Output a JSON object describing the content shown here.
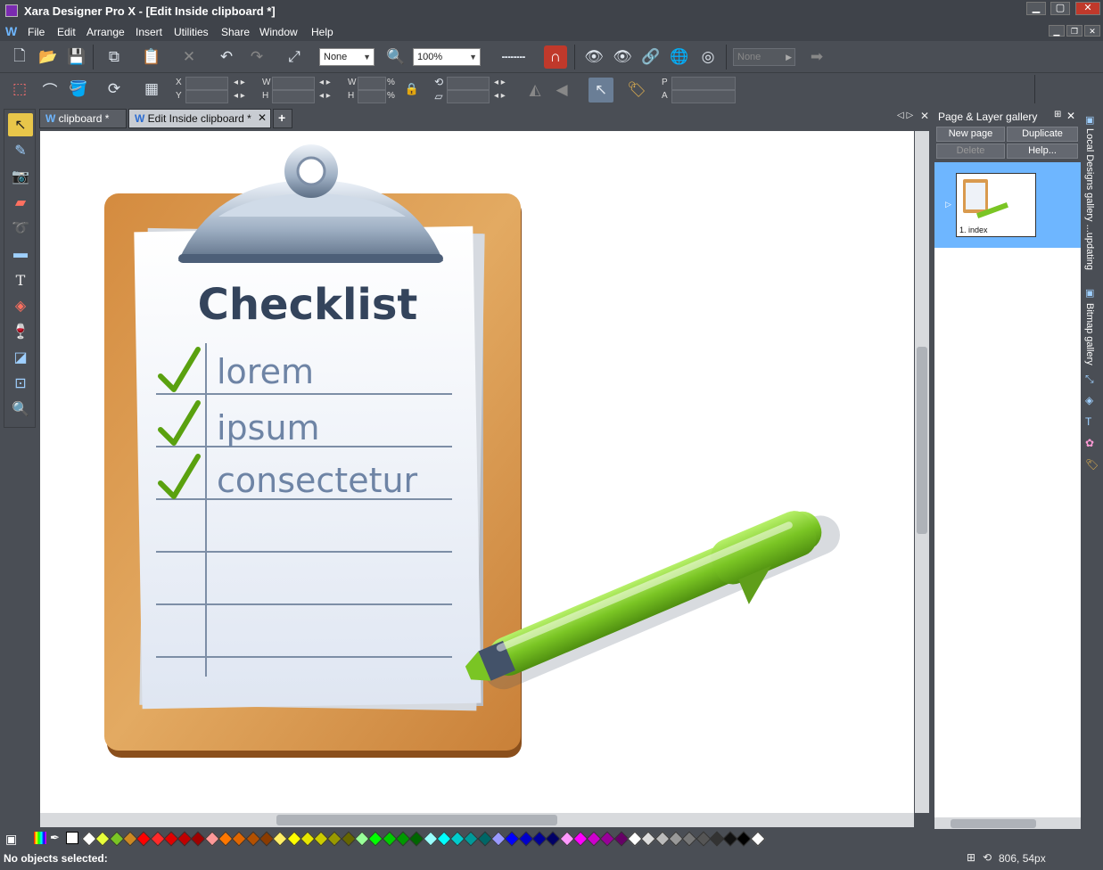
{
  "window": {
    "title": "Xara Designer Pro X - [Edit Inside clipboard *]"
  },
  "menu": [
    "File",
    "Edit",
    "Arrange",
    "Insert",
    "Utilities",
    "Share",
    "Window",
    "Help"
  ],
  "toolbar": {
    "quality_value": "None",
    "zoom_value": "100%",
    "page_select_value": "None"
  },
  "infobar": {
    "labels": {
      "x": "X",
      "y": "Y",
      "w": "W",
      "h": "H",
      "w2": "W",
      "h2": "H",
      "pct1": "%",
      "pct2": "%",
      "p": "P",
      "a": "A"
    }
  },
  "tabs": [
    {
      "label": "clipboard *",
      "active": false
    },
    {
      "label": "Edit Inside clipboard *",
      "active": true
    }
  ],
  "document": {
    "heading": "Checklist",
    "items": [
      "lorem",
      "ipsum",
      "consectetur"
    ]
  },
  "gallery": {
    "title": "Page & Layer gallery",
    "buttons": {
      "new_page": "New page",
      "duplicate": "Duplicate",
      "delete": "Delete",
      "help": "Help..."
    },
    "page_label": "1. index"
  },
  "sidebar": {
    "local_designs": "Local Designs gallery ...updating",
    "bitmap": "Bitmap gallery"
  },
  "status": {
    "selection": "No objects selected:",
    "coords": "806, 54px"
  },
  "colors": {
    "accent_select": "#6eb6ff",
    "pen_green": "#7ac524",
    "board": "#d99a4e"
  },
  "palette": [
    "#ffffff",
    "#e8ff3a",
    "#7ac524",
    "#cc8822",
    "#ff0000",
    "#ff2a2a",
    "#e00000",
    "#c00000",
    "#a00000",
    "#ff9999",
    "#ff7700",
    "#e06600",
    "#b35000",
    "#8a3b00",
    "#ffee66",
    "#ffff00",
    "#e6e600",
    "#cccc00",
    "#999900",
    "#666600",
    "#99ff99",
    "#00ff00",
    "#00cc00",
    "#009900",
    "#006600",
    "#99ffff",
    "#00ffff",
    "#00cccc",
    "#009999",
    "#006666",
    "#9999ff",
    "#0000ff",
    "#0000cc",
    "#000099",
    "#000066",
    "#ff99ff",
    "#ff00ff",
    "#cc00cc",
    "#990099",
    "#660066",
    "#ffffff",
    "#dddddd",
    "#bbbbbb",
    "#999999",
    "#777777",
    "#555555",
    "#333333",
    "#111111",
    "#000000",
    "#ffffff"
  ]
}
